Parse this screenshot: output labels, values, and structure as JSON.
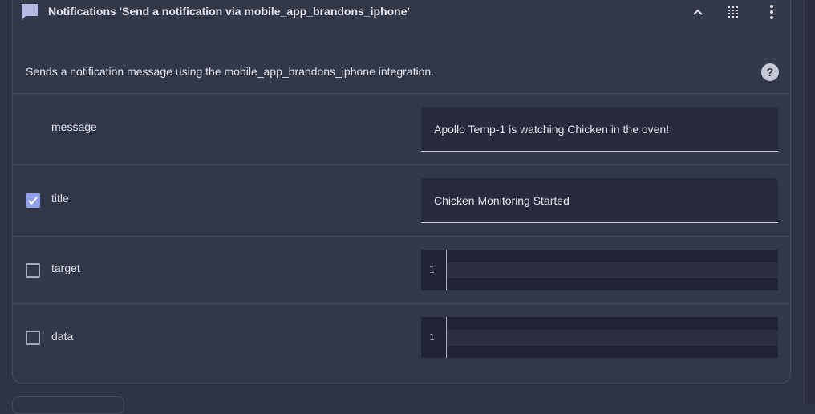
{
  "header": {
    "title": "Notifications 'Send a notification via mobile_app_brandons_iphone'",
    "icon": "message-icon"
  },
  "description": "Sends a notification message using the mobile_app_brandons_iphone integration.",
  "help_glyph": "?",
  "fields": {
    "message": {
      "label": "message",
      "value": "Apollo Temp-1 is watching Chicken in the oven!"
    },
    "title": {
      "label": "title",
      "value": "Chicken Monitoring Started",
      "checked": true
    },
    "target": {
      "label": "target",
      "line_number": "1",
      "checked": false
    },
    "data": {
      "label": "data",
      "line_number": "1",
      "checked": false
    }
  },
  "colors": {
    "background": "#2f3346",
    "card": "#333849",
    "accent": "#8fa0e8"
  }
}
